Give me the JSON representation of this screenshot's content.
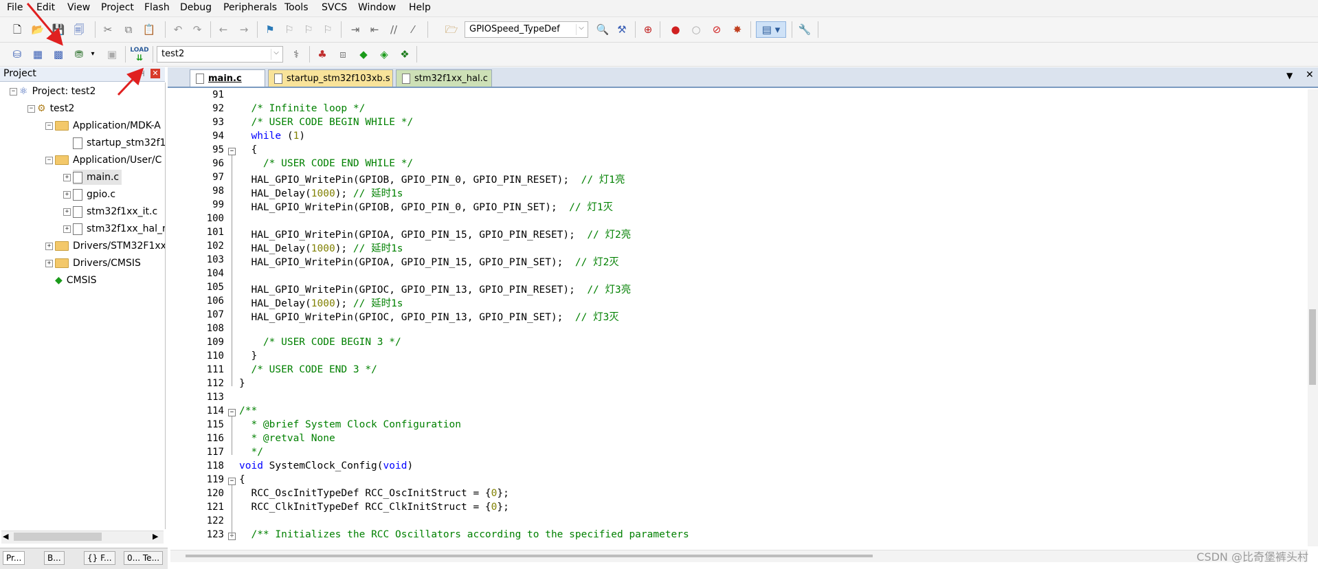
{
  "menu": [
    "File",
    "Edit",
    "View",
    "Project",
    "Flash",
    "Debug",
    "Peripherals",
    "Tools",
    "SVCS",
    "Window",
    "Help"
  ],
  "toolbar1": {
    "function_combo": "GPIOSpeed_TypeDef"
  },
  "toolbar2": {
    "target_combo": "test2"
  },
  "project_panel": {
    "title": "Project",
    "tree": [
      {
        "label": "Project: test2",
        "level": 0,
        "type": "project",
        "expander": "-"
      },
      {
        "label": "test2",
        "level": 1,
        "type": "target",
        "expander": "-"
      },
      {
        "label": "Application/MDK-A",
        "level": 2,
        "type": "folder",
        "expander": "-"
      },
      {
        "label": "startup_stm32f1",
        "level": 3,
        "type": "file",
        "expander": ""
      },
      {
        "label": "Application/User/C",
        "level": 2,
        "type": "folder",
        "expander": "-"
      },
      {
        "label": "main.c",
        "level": 3,
        "type": "file",
        "expander": "+"
      },
      {
        "label": "gpio.c",
        "level": 3,
        "type": "file",
        "expander": "+"
      },
      {
        "label": "stm32f1xx_it.c",
        "level": 3,
        "type": "file",
        "expander": "+"
      },
      {
        "label": "stm32f1xx_hal_r",
        "level": 3,
        "type": "file",
        "expander": "+"
      },
      {
        "label": "Drivers/STM32F1xx_",
        "level": 2,
        "type": "folder",
        "expander": "+"
      },
      {
        "label": "Drivers/CMSIS",
        "level": 2,
        "type": "folder",
        "expander": "+"
      },
      {
        "label": "CMSIS",
        "level": 2,
        "type": "component",
        "expander": ""
      }
    ]
  },
  "tabs": [
    {
      "label": "main.c",
      "active": true
    },
    {
      "label": "startup_stm32f103xb.s",
      "active": false
    },
    {
      "label": "stm32f1xx_hal.c",
      "active": false
    }
  ],
  "bottom_tabs": [
    "Pr...",
    "B...",
    "{} F...",
    "0... Te..."
  ],
  "code_lines": [
    {
      "n": "91",
      "html": ""
    },
    {
      "n": "92",
      "html": "  <span class=\"cm\">/* Infinite loop */</span>"
    },
    {
      "n": "93",
      "html": "  <span class=\"cm\">/* USER CODE BEGIN WHILE */</span>"
    },
    {
      "n": "94",
      "html": "  <span class=\"kw\">while</span> (<span class=\"num\">1</span>)"
    },
    {
      "n": "95",
      "html": "  {"
    },
    {
      "n": "96",
      "html": "    <span class=\"cm\">/* USER CODE END WHILE */</span>"
    },
    {
      "n": "97",
      "html": "  HAL_GPIO_WritePin(GPIOB, GPIO_PIN_0, GPIO_PIN_RESET);  <span class=\"cm\">// 灯1亮</span>"
    },
    {
      "n": "98",
      "html": "  HAL_Delay(<span class=\"num\">1000</span>); <span class=\"cm\">// 延时1s</span>"
    },
    {
      "n": "99",
      "html": "  HAL_GPIO_WritePin(GPIOB, GPIO_PIN_0, GPIO_PIN_SET);  <span class=\"cm\">// 灯1灭</span>"
    },
    {
      "n": "100",
      "html": ""
    },
    {
      "n": "101",
      "html": "  HAL_GPIO_WritePin(GPIOA, GPIO_PIN_15, GPIO_PIN_RESET);  <span class=\"cm\">// 灯2亮</span>"
    },
    {
      "n": "102",
      "html": "  HAL_Delay(<span class=\"num\">1000</span>); <span class=\"cm\">// 延时1s</span>"
    },
    {
      "n": "103",
      "html": "  HAL_GPIO_WritePin(GPIOA, GPIO_PIN_15, GPIO_PIN_SET);  <span class=\"cm\">// 灯2灭</span>"
    },
    {
      "n": "104",
      "html": ""
    },
    {
      "n": "105",
      "html": "  HAL_GPIO_WritePin(GPIOC, GPIO_PIN_13, GPIO_PIN_RESET);  <span class=\"cm\">// 灯3亮</span>"
    },
    {
      "n": "106",
      "html": "  HAL_Delay(<span class=\"num\">1000</span>); <span class=\"cm\">// 延时1s</span>"
    },
    {
      "n": "107",
      "html": "  HAL_GPIO_WritePin(GPIOC, GPIO_PIN_13, GPIO_PIN_SET);  <span class=\"cm\">// 灯3灭</span>"
    },
    {
      "n": "108",
      "html": ""
    },
    {
      "n": "109",
      "html": "    <span class=\"cm\">/* USER CODE BEGIN 3 */</span>"
    },
    {
      "n": "110",
      "html": "  }"
    },
    {
      "n": "111",
      "html": "  <span class=\"cm\">/* USER CODE END 3 */</span>"
    },
    {
      "n": "112",
      "html": "}"
    },
    {
      "n": "113",
      "html": ""
    },
    {
      "n": "114",
      "html": "<span class=\"cm\">/**</span>"
    },
    {
      "n": "115",
      "html": "<span class=\"cm\">  * @brief System Clock Configuration</span>"
    },
    {
      "n": "116",
      "html": "<span class=\"cm\">  * @retval None</span>"
    },
    {
      "n": "117",
      "html": "<span class=\"cm\">  */</span>"
    },
    {
      "n": "118",
      "html": "<span class=\"kw\">void</span> SystemClock_Config(<span class=\"kw\">void</span>)"
    },
    {
      "n": "119",
      "html": "{"
    },
    {
      "n": "120",
      "html": "  RCC_OscInitTypeDef RCC_OscInitStruct = {<span class=\"num\">0</span>};"
    },
    {
      "n": "121",
      "html": "  RCC_ClkInitTypeDef RCC_ClkInitStruct = {<span class=\"num\">0</span>};"
    },
    {
      "n": "122",
      "html": ""
    },
    {
      "n": "123",
      "html": "  <span class=\"cm\">/** Initializes the RCC Oscillators according to the specified parameters</span>"
    }
  ],
  "fold_markers": [
    "95",
    "114",
    "119",
    "123"
  ],
  "watermark": "CSDN @比奇堡裤头村",
  "colors": {
    "comment": "#008000",
    "keyword": "#0000ff",
    "number": "#808000",
    "annotation_arrow": "#e02020"
  }
}
